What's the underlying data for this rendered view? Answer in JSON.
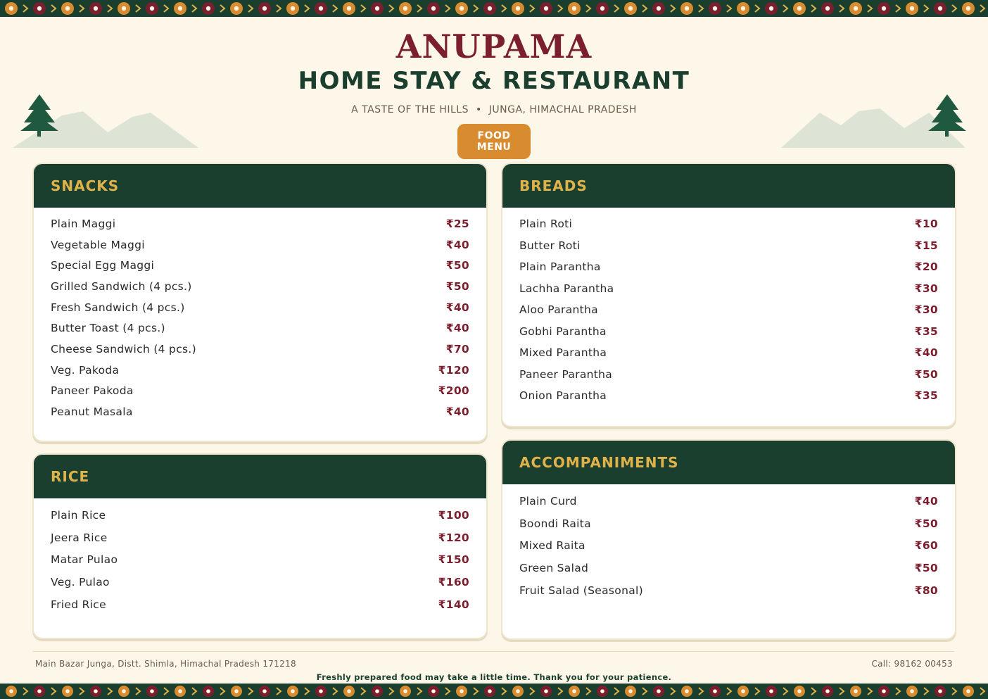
{
  "header": {
    "brand": "ANUPAMA",
    "subtitle": "HOME STAY & RESTAURANT",
    "tagline_left": "A TASTE OF THE HILLS",
    "tagline_separator": "•",
    "tagline_right": "JUNGA, HIMACHAL PRADESH",
    "badge": "FOOD MENU"
  },
  "colors": {
    "background": "#fdf7ea",
    "forest_green": "#1b3f2e",
    "maroon": "#7b1f2e",
    "mustard": "#e0b24a",
    "orange": "#d98c2f",
    "mountain": "#dde4d6"
  },
  "icons": [
    "pine-tree-icon",
    "mountain-icon",
    "pattern-dot-icon",
    "chevron-icon"
  ],
  "sections": {
    "snacks": {
      "title": "SNACKS",
      "items": [
        {
          "name": "Plain Maggi",
          "price": "₹25"
        },
        {
          "name": "Vegetable Maggi",
          "price": "₹40"
        },
        {
          "name": "Special Egg Maggi",
          "price": "₹50"
        },
        {
          "name": "Grilled Sandwich (4 pcs.)",
          "price": "₹50"
        },
        {
          "name": "Fresh Sandwich (4 pcs.)",
          "price": "₹40"
        },
        {
          "name": "Butter Toast (4 pcs.)",
          "price": "₹40"
        },
        {
          "name": "Cheese Sandwich (4 pcs.)",
          "price": "₹70"
        },
        {
          "name": "Veg. Pakoda",
          "price": "₹120"
        },
        {
          "name": "Paneer Pakoda",
          "price": "₹200"
        },
        {
          "name": "Peanut Masala",
          "price": "₹40"
        }
      ]
    },
    "breads": {
      "title": "BREADS",
      "items": [
        {
          "name": "Plain Roti",
          "price": "₹10"
        },
        {
          "name": "Butter Roti",
          "price": "₹15"
        },
        {
          "name": "Plain Parantha",
          "price": "₹20"
        },
        {
          "name": "Lachha Parantha",
          "price": "₹30"
        },
        {
          "name": "Aloo Parantha",
          "price": "₹30"
        },
        {
          "name": "Gobhi Parantha",
          "price": "₹35"
        },
        {
          "name": "Mixed Parantha",
          "price": "₹40"
        },
        {
          "name": "Paneer Parantha",
          "price": "₹50"
        },
        {
          "name": "Onion Parantha",
          "price": "₹35"
        }
      ]
    },
    "rice": {
      "title": "RICE",
      "items": [
        {
          "name": "Plain Rice",
          "price": "₹100"
        },
        {
          "name": "Jeera Rice",
          "price": "₹120"
        },
        {
          "name": "Matar Pulao",
          "price": "₹150"
        },
        {
          "name": "Veg. Pulao",
          "price": "₹160"
        },
        {
          "name": "Fried Rice",
          "price": "₹140"
        }
      ]
    },
    "accompaniments": {
      "title": "ACCOMPANIMENTS",
      "items": [
        {
          "name": "Plain Curd",
          "price": "₹40"
        },
        {
          "name": "Boondi Raita",
          "price": "₹50"
        },
        {
          "name": "Mixed Raita",
          "price": "₹60"
        },
        {
          "name": "Green Salad",
          "price": "₹50"
        },
        {
          "name": "Fruit Salad (Seasonal)",
          "price": "₹80"
        }
      ]
    }
  },
  "footer": {
    "address": "Main Bazar Junga, Distt. Shimla, Himachal Pradesh 171218",
    "phone": "Call: 98162 00453",
    "note": "Freshly prepared food may take a little time. Thank you for your patience."
  }
}
